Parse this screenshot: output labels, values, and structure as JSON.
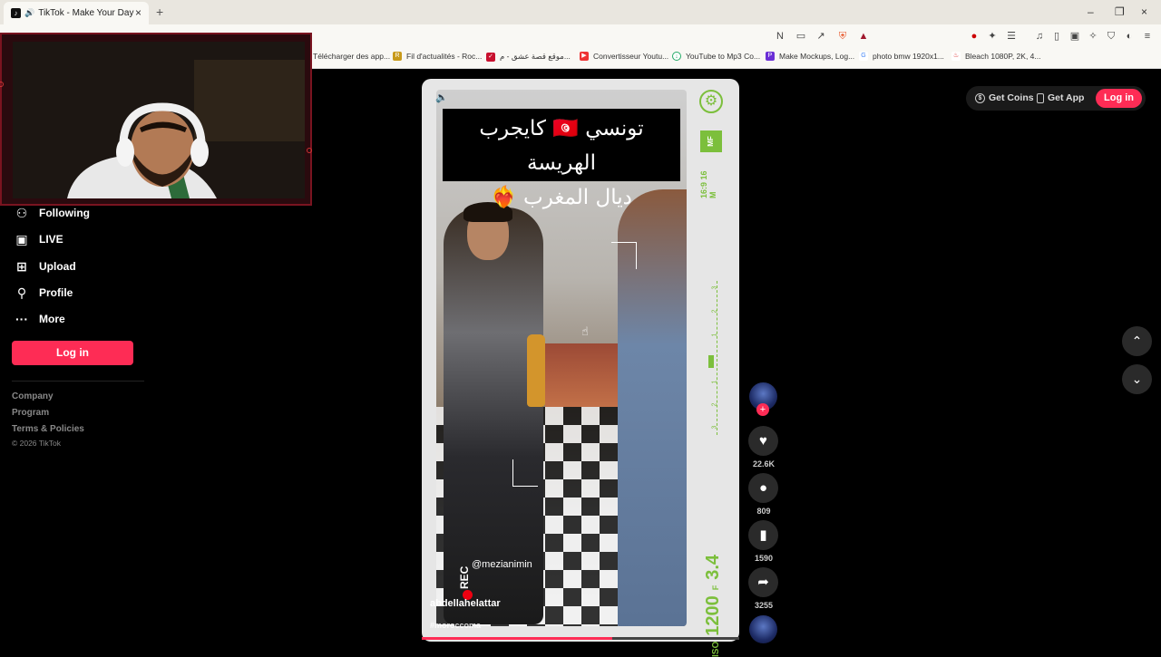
{
  "browser": {
    "tab_title": "TikTok - Make Your Day",
    "tab_close": "×",
    "new_tab": "+",
    "win_min": "–",
    "win_max": "❐",
    "win_close": "×",
    "bookmarks": [
      "Télécharger des app...",
      "Fil d'actualités - Roc...",
      "موقع قصة عشق - م...",
      "Convertisseur Youtu...",
      "YouTube to Mp3 Co...",
      "Make Mockups, Log...",
      "photo bmw 1920x1...",
      "Bleach 1080P, 2K, 4..."
    ]
  },
  "sidebar": {
    "items": [
      {
        "label": "Following",
        "icon": "following-icon"
      },
      {
        "label": "LIVE",
        "icon": "live-icon"
      },
      {
        "label": "Upload",
        "icon": "upload-icon"
      },
      {
        "label": "Profile",
        "icon": "profile-icon"
      },
      {
        "label": "More",
        "icon": "more-icon"
      }
    ],
    "login_label": "Log in",
    "links": [
      "Company",
      "Program",
      "Terms & Policies"
    ],
    "copyright": "© 2026 TikTok"
  },
  "header": {
    "get_coins": "Get Coins",
    "get_app": "Get App",
    "login": "Log in"
  },
  "video": {
    "title_line1": "تونسي 🇹🇳 كايجرب الهريسة",
    "title_line2": "ديال المغرب ❤️‍🔥",
    "mf_label": "MF",
    "resolution": "16:9 16 M",
    "iso_label": "ISO",
    "iso_value": "1200",
    "f_label": "F",
    "f_value": "3.4",
    "rec_label": "REC",
    "mention": "@mezianimin",
    "author": "abdellahelattar",
    "hashtag": "#moroccoma",
    "scale_ticks": [
      "3",
      "2",
      "1",
      "1",
      "2",
      "3"
    ],
    "progress": 0.6
  },
  "actions": {
    "likes": "22.6K",
    "comments": "809",
    "saves": "1590",
    "shares": "3255"
  },
  "colors": {
    "accent": "#fe2c55",
    "camera_green": "#7cbf3c"
  }
}
